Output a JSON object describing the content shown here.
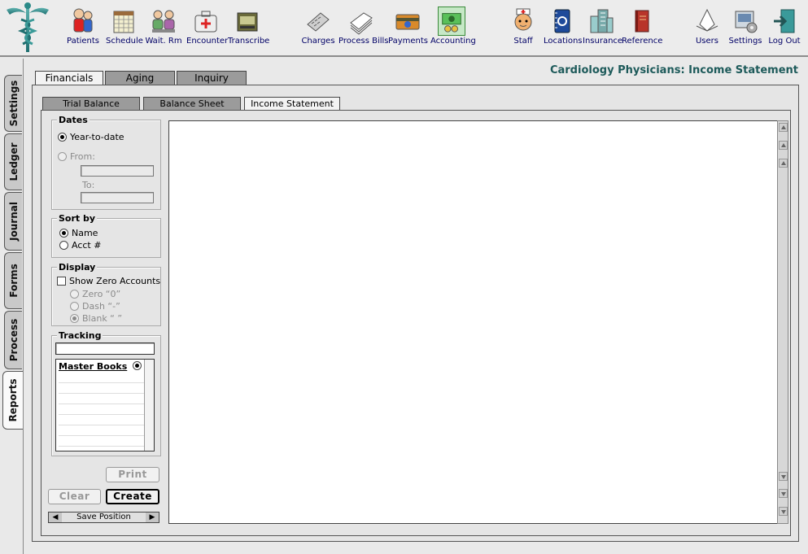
{
  "toolbar": {
    "items": [
      {
        "label": "Patients",
        "icon": "patients-icon"
      },
      {
        "label": "Schedule",
        "icon": "schedule-icon"
      },
      {
        "label": "Wait. Rm",
        "icon": "waiting-room-icon"
      },
      {
        "label": "Encounter",
        "icon": "encounter-icon"
      },
      {
        "label": "Transcribe",
        "icon": "transcribe-icon"
      },
      {
        "label": "Charges",
        "icon": "charges-icon"
      },
      {
        "label": "Process Bills",
        "icon": "process-bills-icon"
      },
      {
        "label": "Payments",
        "icon": "payments-icon"
      },
      {
        "label": "Accounting",
        "icon": "accounting-icon"
      },
      {
        "label": "Staff",
        "icon": "staff-icon"
      },
      {
        "label": "Locations",
        "icon": "locations-icon"
      },
      {
        "label": "Insurance",
        "icon": "insurance-icon"
      },
      {
        "label": "Reference",
        "icon": "reference-icon"
      },
      {
        "label": "Users",
        "icon": "users-icon"
      },
      {
        "label": "Settings",
        "icon": "settings-icon"
      },
      {
        "label": "Log Out",
        "icon": "logout-icon"
      }
    ]
  },
  "side_tabs": [
    {
      "label": "Settings",
      "active": false
    },
    {
      "label": "Ledger",
      "active": false
    },
    {
      "label": "Journal",
      "active": false
    },
    {
      "label": "Forms",
      "active": false
    },
    {
      "label": "Process",
      "active": false
    },
    {
      "label": "Reports",
      "active": true
    }
  ],
  "page_title": "Cardiology Physicians: Income Statement",
  "main_tabs": [
    {
      "label": "Financials",
      "active": true
    },
    {
      "label": "Aging",
      "active": false
    },
    {
      "label": "Inquiry",
      "active": false
    }
  ],
  "sub_tabs": [
    {
      "label": "Trial Balance",
      "active": false
    },
    {
      "label": "Balance Sheet",
      "active": false
    },
    {
      "label": "Income Statement",
      "active": true
    }
  ],
  "dates": {
    "title": "Dates",
    "ytd_label": "Year-to-date",
    "from_label": "From:",
    "to_label": "To:",
    "from_value": "",
    "to_value": ""
  },
  "sort_by": {
    "title": "Sort by",
    "name_label": "Name",
    "acct_label": "Acct #"
  },
  "display": {
    "title": "Display",
    "show_zero_label": "Show Zero Accounts",
    "zero_label": "Zero “0”",
    "dash_label": "Dash “-”",
    "blank_label": "Blank “ ”"
  },
  "tracking": {
    "title": "Tracking",
    "filter_value": "",
    "list_header": "Master Books"
  },
  "buttons": {
    "print": "Print",
    "clear": "Clear",
    "create": "Create",
    "save_position": "Save Position"
  },
  "colors": {
    "title": "#1d5a5a",
    "toolbar_label": "#000066"
  }
}
